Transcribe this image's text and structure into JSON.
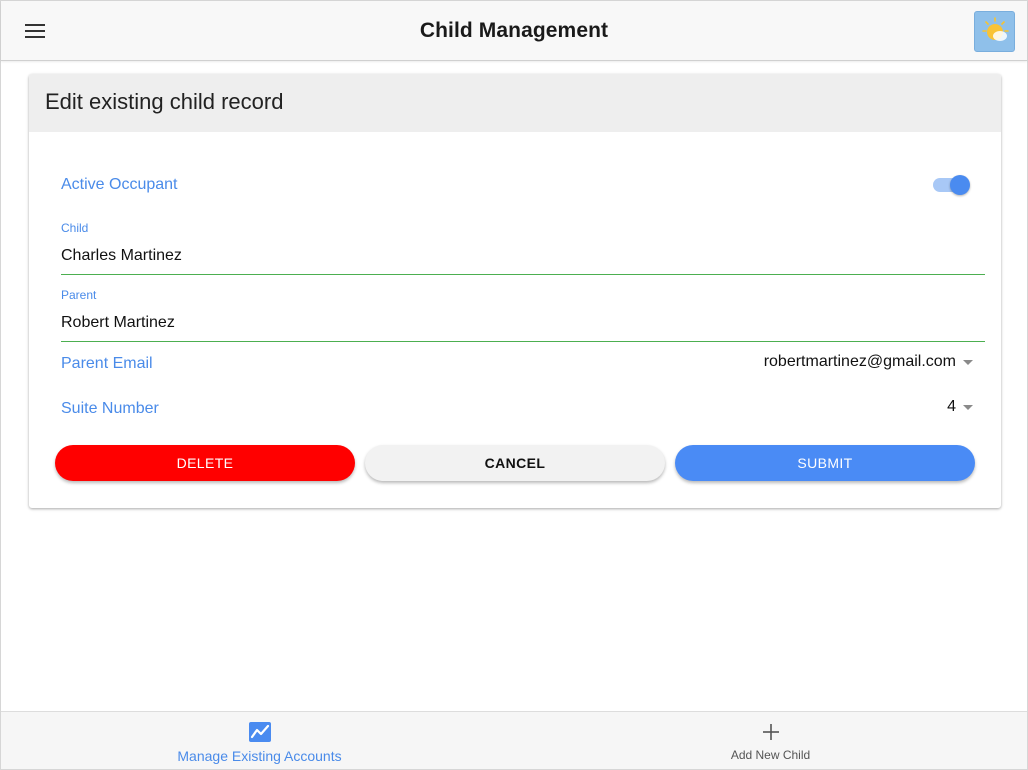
{
  "header": {
    "title": "Child Management",
    "menu_icon": "hamburger-menu-icon",
    "theme_icon": "sun-cloud-icon"
  },
  "card": {
    "title": "Edit existing child record",
    "active": {
      "label": "Active Occupant",
      "on": true
    },
    "child": {
      "label": "Child",
      "value": "Charles Martinez"
    },
    "parent": {
      "label": "Parent",
      "value": "Robert Martinez"
    },
    "parent_email": {
      "label": "Parent Email",
      "value": "robertmartinez@gmail.com"
    },
    "suite_number": {
      "label": "Suite Number",
      "value": "4"
    },
    "buttons": {
      "delete": "DELETE",
      "cancel": "CANCEL",
      "submit": "SUBMIT"
    }
  },
  "bottom_nav": {
    "items": [
      {
        "label": "Manage Existing Accounts",
        "icon": "chart-icon",
        "active": true
      },
      {
        "label": "Add New Child",
        "icon": "plus-icon",
        "active": false
      }
    ]
  },
  "colors": {
    "accent": "#4a8be9",
    "delete": "#ff0000",
    "submit": "#4a8bf5",
    "underline": "#4caf50"
  }
}
